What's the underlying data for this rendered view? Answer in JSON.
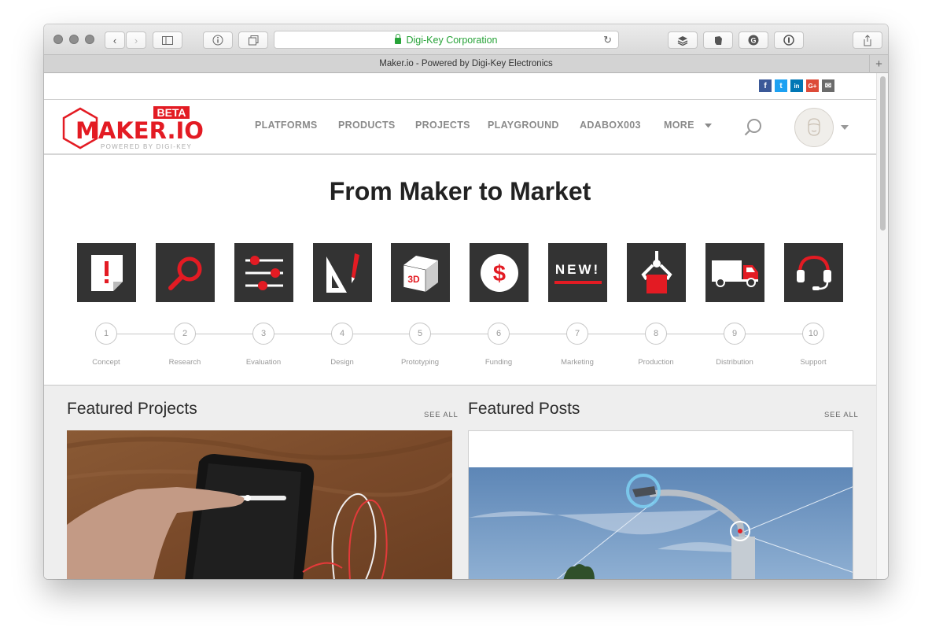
{
  "browser": {
    "address": "Digi-Key Corporation",
    "tab_title": "Maker.io - Powered by Digi-Key Electronics"
  },
  "header": {
    "logo_text": "MAKER.IO",
    "logo_badge": "BETA",
    "logo_tagline": "POWERED BY DIGI-KEY",
    "nav": [
      "PLATFORMS",
      "PRODUCTS",
      "PROJECTS",
      "PLAYGROUND",
      "ADABOX003",
      "MORE"
    ]
  },
  "social": [
    {
      "name": "facebook",
      "glyph": "f",
      "color": "#3b5998"
    },
    {
      "name": "twitter",
      "glyph": "t",
      "color": "#1da1f2"
    },
    {
      "name": "linkedin",
      "glyph": "in",
      "color": "#0077b5"
    },
    {
      "name": "google-plus",
      "glyph": "G+",
      "color": "#dd4b39"
    },
    {
      "name": "email",
      "glyph": "✉",
      "color": "#6b6b6b"
    }
  ],
  "hero": {
    "title": "From Maker to Market",
    "steps": [
      {
        "num": "1",
        "label": "Concept",
        "icon": "concept-icon"
      },
      {
        "num": "2",
        "label": "Research",
        "icon": "research-icon"
      },
      {
        "num": "3",
        "label": "Evaluation",
        "icon": "evaluation-icon"
      },
      {
        "num": "4",
        "label": "Design",
        "icon": "design-icon"
      },
      {
        "num": "5",
        "label": "Prototyping",
        "icon": "prototyping-icon"
      },
      {
        "num": "6",
        "label": "Funding",
        "icon": "funding-icon"
      },
      {
        "num": "7",
        "label": "Marketing",
        "icon": "marketing-icon"
      },
      {
        "num": "8",
        "label": "Production",
        "icon": "production-icon"
      },
      {
        "num": "9",
        "label": "Distribution",
        "icon": "distribution-icon"
      },
      {
        "num": "10",
        "label": "Support",
        "icon": "support-icon"
      }
    ],
    "tile_text": {
      "prototyping": "3D",
      "marketing": "NEW!",
      "funding": "$",
      "concept": "!"
    }
  },
  "featured_projects": {
    "title": "Featured Projects",
    "see_all": "SEE ALL"
  },
  "featured_posts": {
    "title": "Featured Posts",
    "see_all": "SEE ALL"
  },
  "colors": {
    "accent": "#e31b23",
    "tile": "#333333"
  }
}
